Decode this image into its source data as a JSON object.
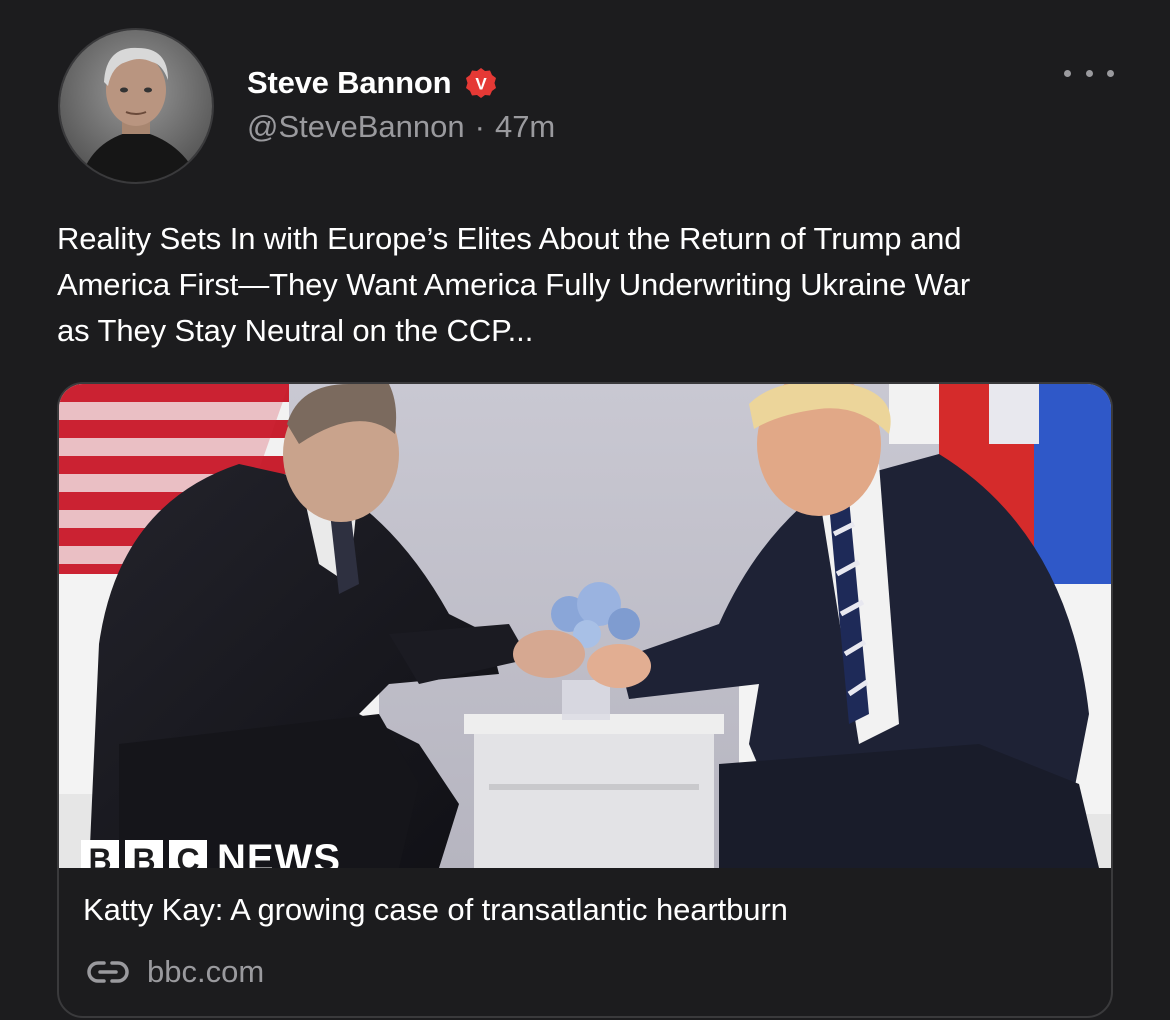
{
  "author": {
    "display_name": "Steve Bannon",
    "handle": "@SteveBannon",
    "separator": "·",
    "timestamp": "47m",
    "badge_icon": "verified-v-icon",
    "badge_letter": "V",
    "badge_color": "#e53935"
  },
  "post": {
    "text_lines": [
      "Reality Sets In with Europe’s Elites About the Return of Trump and",
      "America First—They Want America Fully Underwriting Ukraine War",
      "as They Stay Neutral on the CCP..."
    ]
  },
  "link_card": {
    "image_logo": {
      "letters": [
        "B",
        "B",
        "C"
      ],
      "word": "NEWS"
    },
    "title": "Katty Kay: A growing case of transatlantic heartburn",
    "domain": "bbc.com",
    "domain_icon": "link-icon"
  },
  "menu": {
    "icon": "more-options-icon"
  },
  "colors": {
    "background": "#1c1c1e",
    "primary_text": "#ffffff",
    "secondary_text": "#9a9a9e",
    "border": "#3a3a3c"
  }
}
